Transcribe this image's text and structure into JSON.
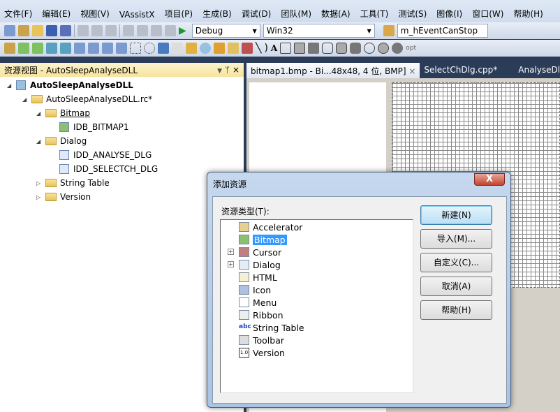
{
  "menu": [
    "文件(F)",
    "编辑(E)",
    "视图(V)",
    "VAssistX",
    "项目(P)",
    "生成(B)",
    "调试(D)",
    "团队(M)",
    "数据(A)",
    "工具(T)",
    "测试(S)",
    "图像(I)",
    "窗口(W)",
    "帮助(H)"
  ],
  "toolbar": {
    "config": "Debug",
    "platform": "Win32",
    "find": "m_hEventCanStop",
    "opt": "opt"
  },
  "left_panel": {
    "title": "资源视图 - AutoSleepAnalyseDLL",
    "pin": "ᛘ",
    "close": "×",
    "tree": {
      "project": "AutoSleepAnalyseDLL",
      "rc": "AutoSleepAnalyseDLL.rc*",
      "bitmap": "Bitmap",
      "bitmap1": "IDB_BITMAP1",
      "dialog": "Dialog",
      "dlg1": "IDD_ANALYSE_DLG",
      "dlg2": "IDD_SELECTCH_DLG",
      "string": "String Table",
      "version": "Version"
    }
  },
  "tabs": [
    {
      "label": "bitmap1.bmp - Bi...48x48, 4 位, BMP]",
      "close": "×"
    },
    {
      "label": "SelectChDlg.cpp*"
    },
    {
      "label": "AnalyseDlg"
    }
  ],
  "dialog": {
    "title": "添加资源",
    "close": "X",
    "list_label": "资源类型(T):",
    "items": [
      "Accelerator",
      "Bitmap",
      "Cursor",
      "Dialog",
      "HTML",
      "Icon",
      "Menu",
      "Ribbon",
      "String Table",
      "Toolbar",
      "Version"
    ],
    "selected": "Bitmap",
    "buttons": [
      "新建(N)",
      "导入(M)...",
      "自定义(C)...",
      "取消(A)",
      "帮助(H)"
    ]
  }
}
